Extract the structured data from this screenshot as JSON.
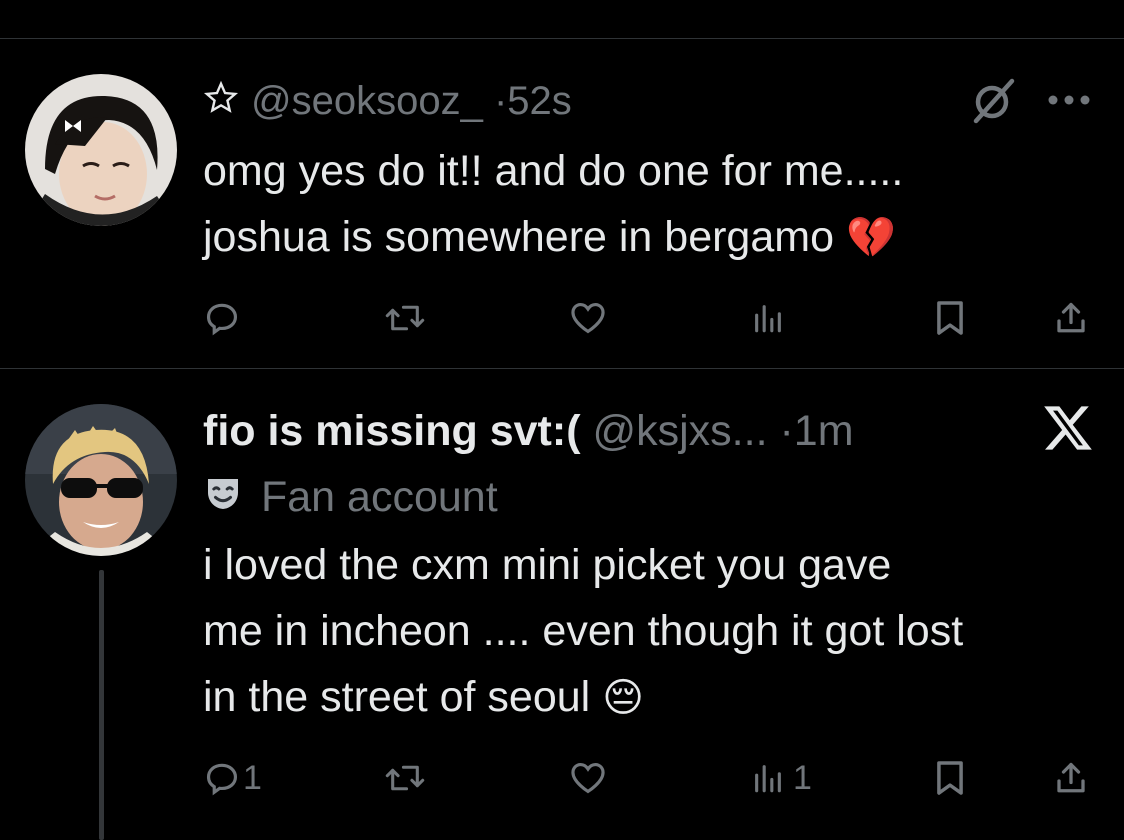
{
  "tweets": [
    {
      "display_name": "",
      "prefix_icon": "star-outline-icon",
      "handle": "@seoksooz_",
      "dot": "·",
      "time": "52s",
      "lines": [
        "omg yes do it!! and do one for me.....",
        "joshua is somewhere in bergamo"
      ],
      "emoji": "💔",
      "menu_label": "···",
      "actions": {
        "reply": "",
        "retweet": "",
        "like": "",
        "views": "",
        "bookmark": "",
        "share": ""
      }
    },
    {
      "display_name": "fio is missing svt:(",
      "handle": "@ksjxs...",
      "dot": "·",
      "time": "1m",
      "badge_icon": "masks-icon",
      "badge_label": "Fan account",
      "lines": [
        "i loved the cxm mini picket you gave",
        "me in incheon .... even though it got lost",
        "in the street of seoul"
      ],
      "emoji": "😔",
      "actions": {
        "reply": "1",
        "retweet": "",
        "like": "",
        "views": "1",
        "bookmark": "",
        "share": ""
      }
    }
  ],
  "colors": {
    "background": "#000000",
    "text": "#e7e9ea",
    "muted": "#71767b",
    "divider": "#2f3336"
  }
}
